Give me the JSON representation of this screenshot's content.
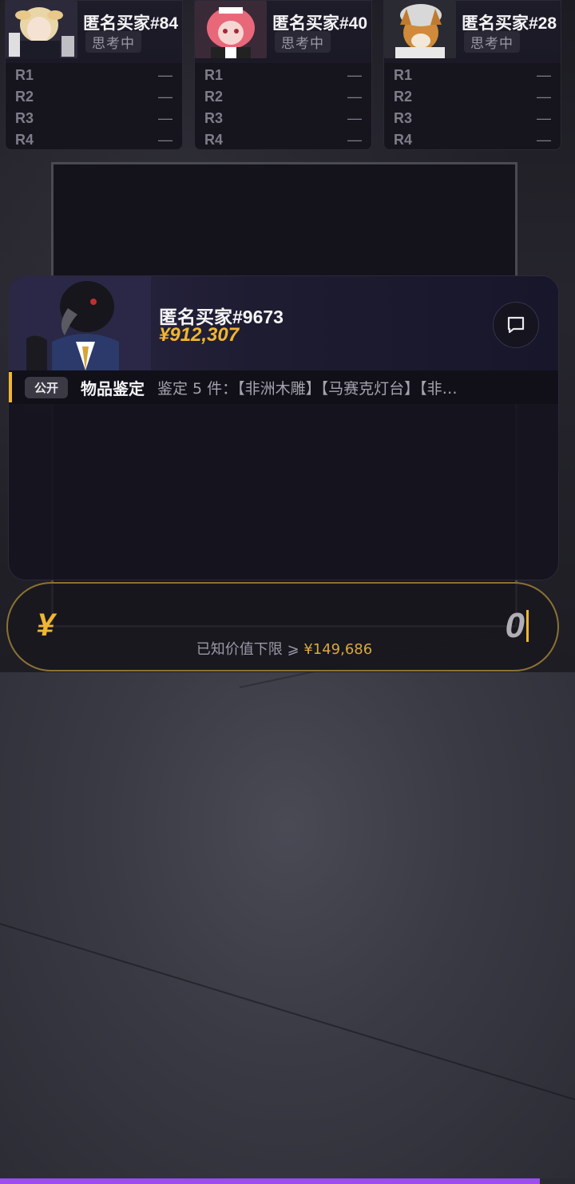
{
  "buyers": [
    {
      "name": "匿名买家#84",
      "status": "思考中",
      "rounds": [
        {
          "label": "R1",
          "value": "—"
        },
        {
          "label": "R2",
          "value": "—"
        },
        {
          "label": "R3",
          "value": "—"
        },
        {
          "label": "R4",
          "value": "—"
        }
      ]
    },
    {
      "name": "匿名买家#40",
      "status": "思考中",
      "rounds": [
        {
          "label": "R1",
          "value": "—"
        },
        {
          "label": "R2",
          "value": "—"
        },
        {
          "label": "R3",
          "value": "—"
        },
        {
          "label": "R4",
          "value": "—"
        }
      ]
    },
    {
      "name": "匿名买家#28",
      "status": "思考中",
      "rounds": [
        {
          "label": "R1",
          "value": "—"
        },
        {
          "label": "R2",
          "value": "—"
        },
        {
          "label": "R3",
          "value": "—"
        },
        {
          "label": "R4",
          "value": "—"
        }
      ]
    }
  ],
  "player": {
    "name": "匿名买家#9673",
    "money": "¥912,307",
    "chat_icon": "chat-bubble-icon"
  },
  "info": {
    "badge": "公开",
    "title": "物品鉴定",
    "description": "鉴定 5 件：【非洲木雕】【马赛克灯台】【非…"
  },
  "bid": {
    "currency": "¥",
    "value": "0",
    "hint_prefix": "已知价值下限 ⩾",
    "hint_amount": "¥149,686"
  },
  "colors": {
    "accent": "#f0b630",
    "progress": "#9b4df0"
  }
}
